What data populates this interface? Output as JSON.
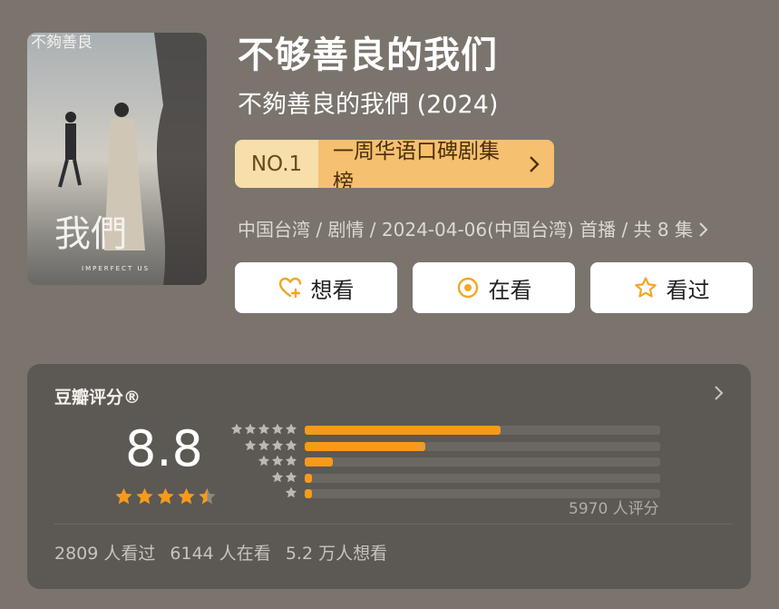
{
  "colors": {
    "background": "#7a746d",
    "card": "#5c5854",
    "accent": "#f79a1a",
    "rank_no_bg": "#f6dfa9",
    "rank_name_bg": "#f5c06f"
  },
  "poster": {
    "calligraphy_top": "不夠善良",
    "calligraphy_bottom": "我們",
    "english_title": "IMPERFECT US"
  },
  "title": "不够善良的我们",
  "subtitle": "不夠善良的我們 (2024)",
  "rank": {
    "number": "NO.1",
    "list_name": "一周华语口碑剧集榜",
    "icon": "chevron-right-icon"
  },
  "meta": {
    "text": "中国台湾 / 剧情 / 2024-04-06(中国台湾) 首播 / 共 8 集",
    "icon": "chevron-right-icon"
  },
  "actions": [
    {
      "label": "想看",
      "icon": "heart-plus-icon"
    },
    {
      "label": "在看",
      "icon": "target-icon"
    },
    {
      "label": "看过",
      "icon": "star-outline-icon"
    }
  ],
  "rating": {
    "heading": "豆瓣评分®",
    "score": "8.8",
    "star_level": 4.5,
    "distribution": [
      {
        "stars": 5,
        "fraction": 0.55
      },
      {
        "stars": 4,
        "fraction": 0.34
      },
      {
        "stars": 3,
        "fraction": 0.08
      },
      {
        "stars": 2,
        "fraction": 0.02
      },
      {
        "stars": 1,
        "fraction": 0.02
      }
    ],
    "count_label": "5970 人评分"
  },
  "stats": {
    "watched": "2809 人看过",
    "watching": "6144 人在看",
    "wishlist": "5.2 万人想看"
  }
}
